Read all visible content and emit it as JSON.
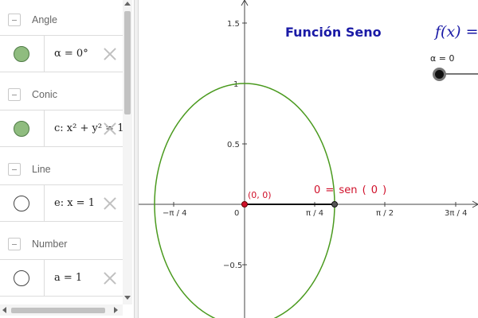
{
  "algebra": {
    "groups": [
      {
        "label": "Angle",
        "item": {
          "text": "α = 0°",
          "marble": "filled"
        }
      },
      {
        "label": "Conic",
        "item": {
          "text": "c: x² + y² = 1",
          "marble": "filled"
        }
      },
      {
        "label": "Line",
        "item": {
          "text": "e: x = 1",
          "marble": "empty"
        }
      },
      {
        "label": "Number",
        "item": {
          "text": "a = 1",
          "marble": "empty"
        }
      }
    ]
  },
  "graphics": {
    "title": "Función Seno",
    "formula": "f(x) =",
    "slider": {
      "label": "α = 0",
      "value": 0
    },
    "point_label": "(0, 0)",
    "equation_label": "0 = sen ( 0 )",
    "x_ticks": [
      "−π / 4",
      "0",
      "π / 4",
      "π / 2",
      "3π / 4"
    ],
    "y_ticks": [
      "1.5",
      "1",
      "0.5",
      "−0.5"
    ],
    "colors": {
      "title": "#1a1aa6",
      "circle": "#4a9a1e",
      "point": "#d0102a",
      "label": "#d0102a"
    }
  }
}
